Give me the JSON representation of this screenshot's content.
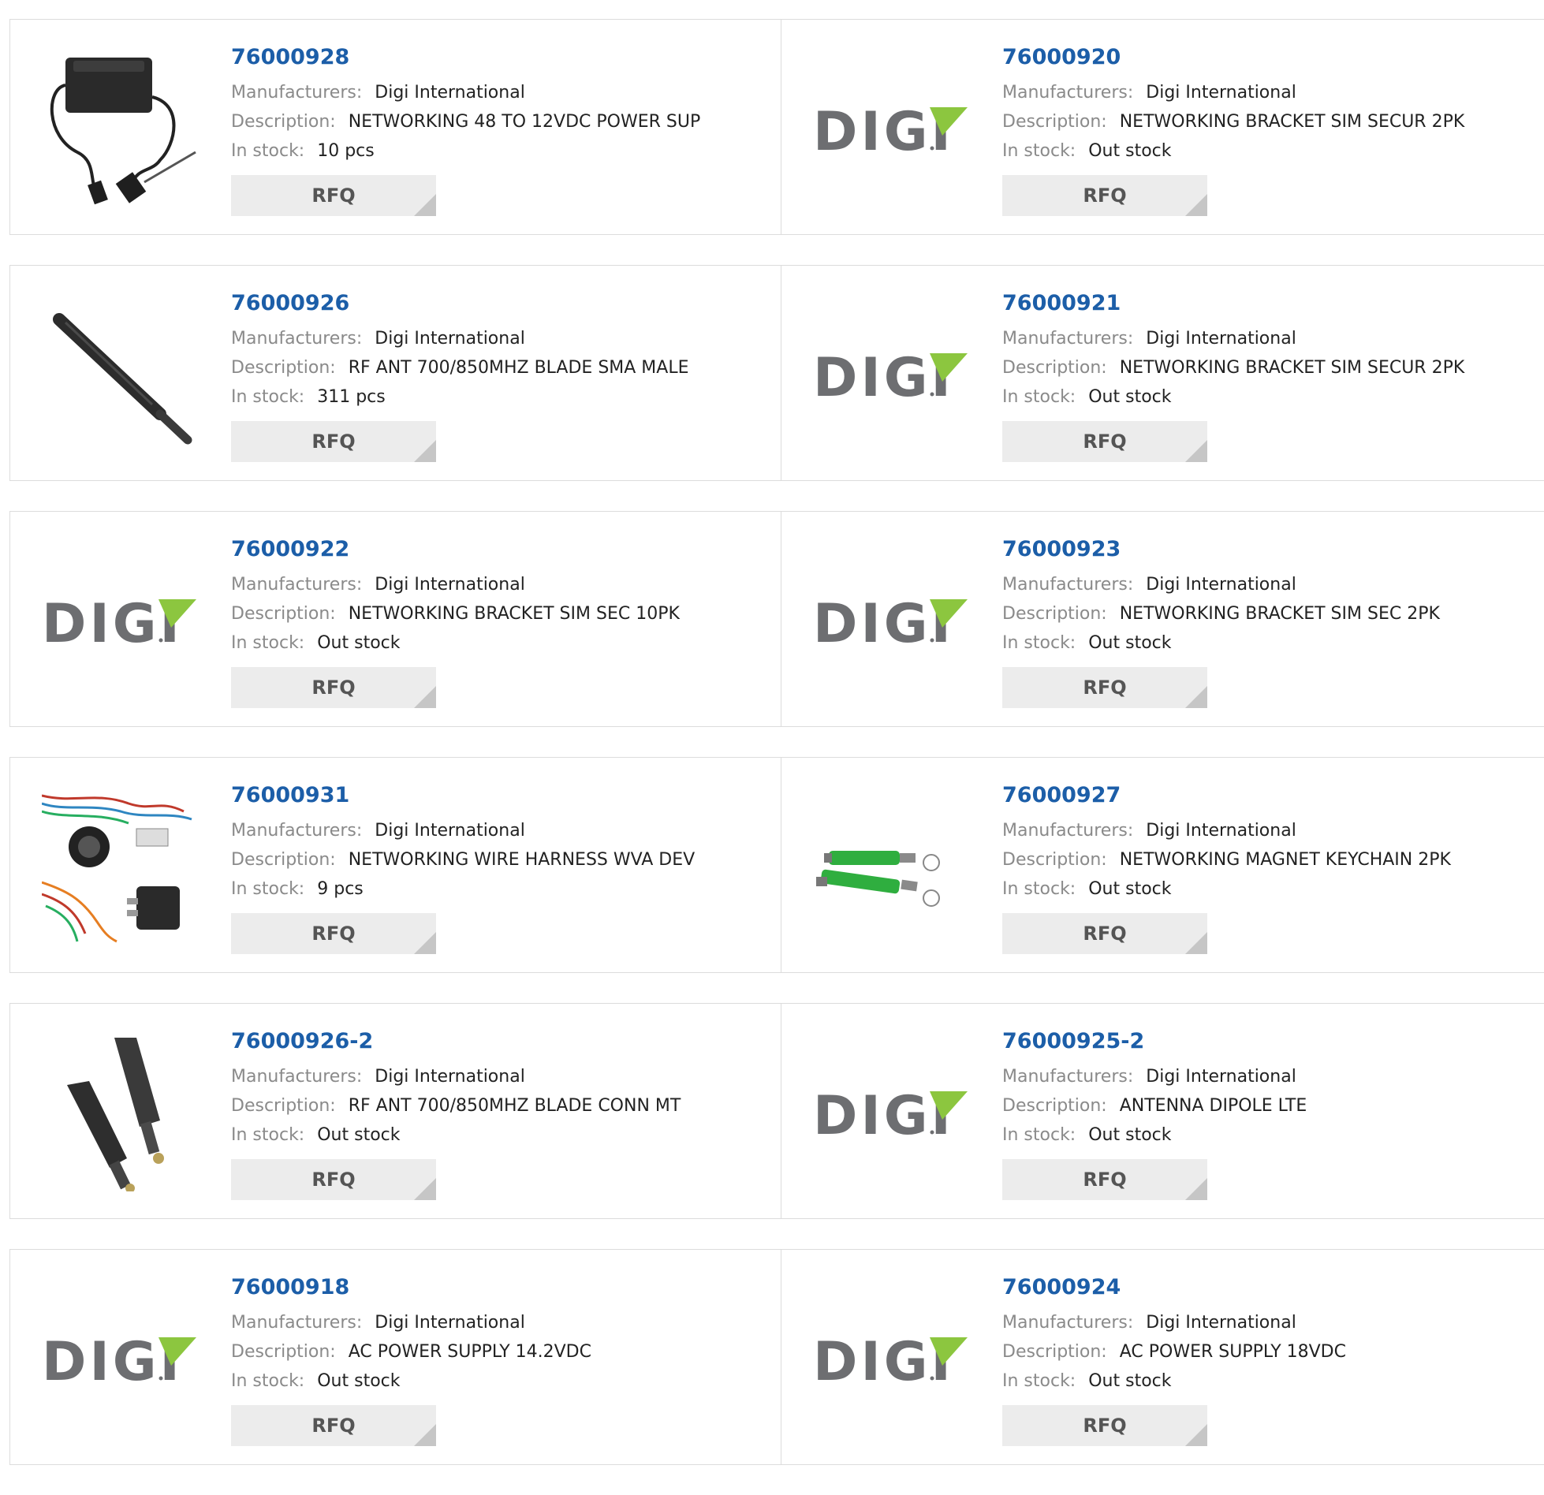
{
  "labels": {
    "manufacturers": "Manufacturers:",
    "description": "Description:",
    "stock": "In stock:",
    "rfq": "RFQ"
  },
  "colors": {
    "part_link": "#1c5ea8",
    "label_gray": "#8a8a8a",
    "rfq_bg": "#ececec",
    "digi_green": "#8cc63f",
    "digi_gray": "#6d6e71"
  },
  "products": [
    {
      "part": "76000928",
      "manufacturer": "Digi International",
      "description": "NETWORKING 48 TO 12VDC POWER SUP",
      "stock": "10 pcs",
      "image": "power-adapter-photo"
    },
    {
      "part": "76000920",
      "manufacturer": "Digi International",
      "description": "NETWORKING BRACKET SIM SECUR 2PK",
      "stock": "Out stock",
      "image": "digi-logo"
    },
    {
      "part": "76000926",
      "manufacturer": "Digi International",
      "description": "RF ANT 700/850MHZ BLADE SMA MALE",
      "stock": "311 pcs",
      "image": "antenna-photo"
    },
    {
      "part": "76000921",
      "manufacturer": "Digi International",
      "description": "NETWORKING BRACKET SIM SECUR 2PK",
      "stock": "Out stock",
      "image": "digi-logo"
    },
    {
      "part": "76000922",
      "manufacturer": "Digi International",
      "description": "NETWORKING BRACKET SIM SEC 10PK",
      "stock": "Out stock",
      "image": "digi-logo"
    },
    {
      "part": "76000923",
      "manufacturer": "Digi International",
      "description": "NETWORKING BRACKET SIM SEC 2PK",
      "stock": "Out stock",
      "image": "digi-logo"
    },
    {
      "part": "76000931",
      "manufacturer": "Digi International",
      "description": "NETWORKING WIRE HARNESS WVA DEV",
      "stock": "9 pcs",
      "image": "wire-harness-photo"
    },
    {
      "part": "76000927",
      "manufacturer": "Digi International",
      "description": "NETWORKING MAGNET KEYCHAIN 2PK",
      "stock": "Out stock",
      "image": "magnet-keychain-photo"
    },
    {
      "part": "76000926-2",
      "manufacturer": "Digi International",
      "description": "RF ANT 700/850MHZ BLADE CONN MT",
      "stock": "Out stock",
      "image": "blade-antenna-pair-photo"
    },
    {
      "part": "76000925-2",
      "manufacturer": "Digi International",
      "description": "ANTENNA DIPOLE LTE",
      "stock": "Out stock",
      "image": "digi-logo"
    },
    {
      "part": "76000918",
      "manufacturer": "Digi International",
      "description": "AC POWER SUPPLY 14.2VDC",
      "stock": "Out stock",
      "image": "digi-logo"
    },
    {
      "part": "76000924",
      "manufacturer": "Digi International",
      "description": "AC POWER SUPPLY 18VDC",
      "stock": "Out stock",
      "image": "digi-logo"
    }
  ]
}
